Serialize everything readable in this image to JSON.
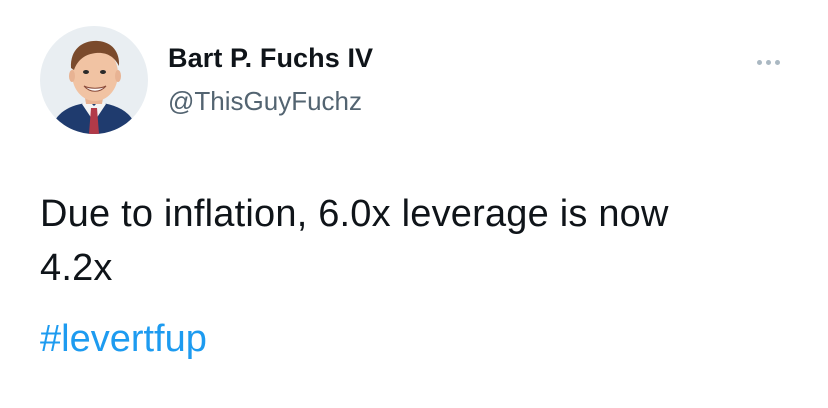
{
  "tweet": {
    "author_name": "Bart P. Fuchs IV",
    "author_handle": "@ThisGuyFuchz",
    "text_line1": "Due to inflation, 6.0x leverage is now",
    "text_line2": "4.2x",
    "hashtag": "#levertfup",
    "avatar_icon": "avatar-portrait",
    "more_icon": "more-options-icon"
  },
  "colors": {
    "name": "#0f1419",
    "handle": "#536471",
    "hashtag": "#1d9bf0",
    "more_dots": "#aab8c2"
  }
}
